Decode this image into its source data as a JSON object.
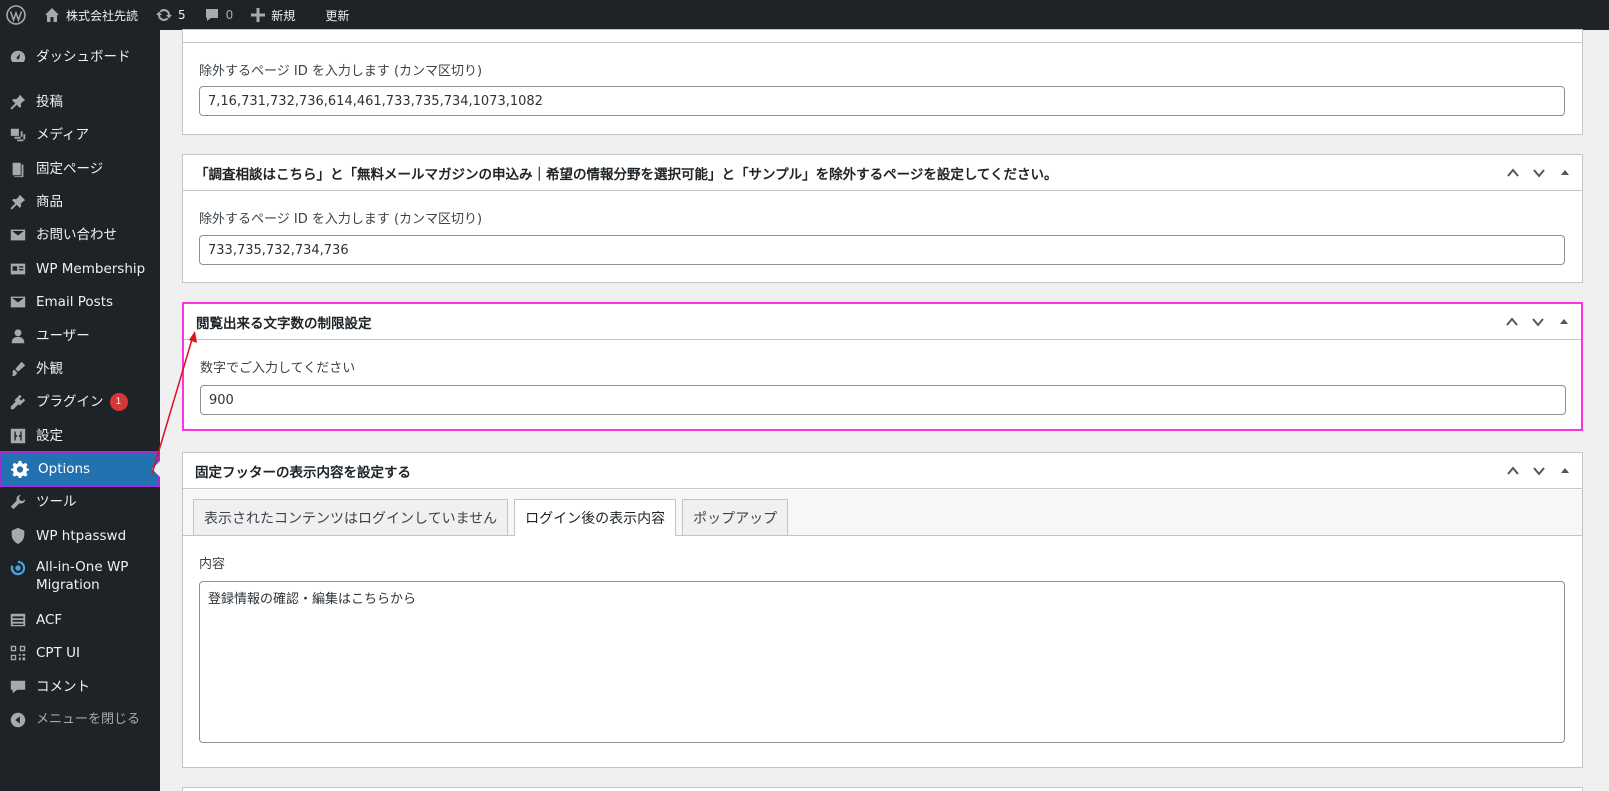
{
  "adminbar": {
    "site_name": "株式会社先読",
    "updates_count": "5",
    "comments_count": "0",
    "new_label": "新規",
    "update_label": "更新"
  },
  "sidebar": {
    "items": [
      {
        "label": "ダッシュボード",
        "icon": "dashboard-icon"
      },
      {
        "label": "投稿",
        "icon": "pin-icon"
      },
      {
        "label": "メディア",
        "icon": "media-icon"
      },
      {
        "label": "固定ページ",
        "icon": "page-icon"
      },
      {
        "label": "商品",
        "icon": "pin-icon"
      },
      {
        "label": "お問い合わせ",
        "icon": "mail-icon"
      },
      {
        "label": "WP Membership",
        "icon": "id-card-icon"
      },
      {
        "label": "Email Posts",
        "icon": "mail-icon"
      },
      {
        "label": "ユーザー",
        "icon": "user-icon"
      },
      {
        "label": "外観",
        "icon": "brush-icon"
      },
      {
        "label": "プラグイン",
        "icon": "plugin-icon",
        "badge": "1"
      },
      {
        "label": "設定",
        "icon": "settings-icon"
      },
      {
        "label": "Options",
        "icon": "gear-icon"
      },
      {
        "label": "ツール",
        "icon": "wrench-icon"
      },
      {
        "label": "WP htpasswd",
        "icon": "shield-icon"
      },
      {
        "label": "All-in-One WP Migration",
        "icon": "migration-icon"
      },
      {
        "label": "ACF",
        "icon": "table-icon"
      },
      {
        "label": "CPT UI",
        "icon": "qr-icon"
      },
      {
        "label": "コメント",
        "icon": "comment-icon"
      },
      {
        "label": "メニューを閉じる",
        "icon": "collapse-icon"
      }
    ]
  },
  "panel1": {
    "label": "除外するページ ID を入力します (カンマ区切り)",
    "value": "7,16,731,732,736,614,461,733,735,734,1073,1082"
  },
  "panel2": {
    "title": "「調査相談はこちら」と「無料メールマガジンの申込み｜希望の情報分野を選択可能」と「サンプル」を除外するページを設定してください。",
    "label": "除外するページ ID を入力します (カンマ区切り)",
    "value": "733,735,732,734,736"
  },
  "panel3": {
    "title": "閲覧出来る文字数の制限設定",
    "label": "数字でご入力してください",
    "value": "900"
  },
  "panel4": {
    "title": "固定フッターの表示内容を設定する",
    "tabs": [
      "表示されたコンテンツはログインしていません",
      "ログイン後の表示内容",
      "ポップアップ"
    ],
    "content_label": "内容",
    "content_value": "登録情報の確認・編集はこちらから"
  },
  "colors": {
    "sidebar_bg": "#1d2327",
    "active_bg": "#2271b1",
    "highlight_border": "#ff33dd",
    "arrow": "#e0101e",
    "badge": "#d63638"
  }
}
